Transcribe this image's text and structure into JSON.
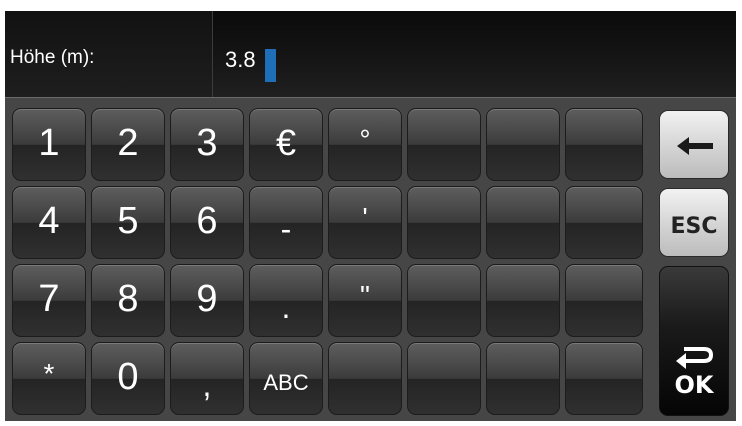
{
  "field": {
    "label": "Höhe (m):",
    "value": "3.8"
  },
  "keyboard": {
    "rows": [
      [
        "1",
        "2",
        "3",
        "€",
        "°",
        "",
        "",
        ""
      ],
      [
        "4",
        "5",
        "6",
        "-",
        "'",
        "",
        "",
        ""
      ],
      [
        "7",
        "8",
        "9",
        ".",
        "\"",
        "",
        "",
        ""
      ],
      [
        "*",
        "0",
        ",",
        "ABC",
        "",
        "",
        "",
        ""
      ]
    ],
    "esc_label": "ESC",
    "ok_label": "OK",
    "backspace_icon": "left-arrow-icon",
    "return_icon": "return-arrow-icon"
  },
  "colors": {
    "cursor": "#1f6fb8",
    "key_dark": "#303030",
    "key_light": "#d6d6d6",
    "background": "#464646"
  }
}
